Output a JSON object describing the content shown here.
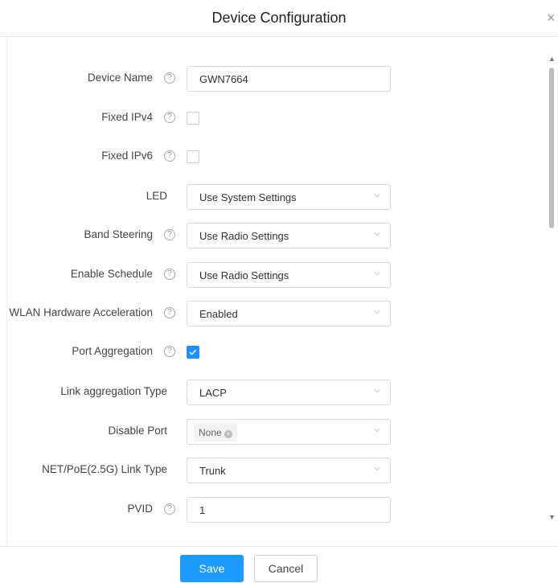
{
  "dialog": {
    "title": "Device Configuration",
    "close_icon": "×"
  },
  "form": {
    "device_name": {
      "label": "Device Name",
      "value": "GWN7664"
    },
    "fixed_ipv4": {
      "label": "Fixed IPv4",
      "checked": false
    },
    "fixed_ipv6": {
      "label": "Fixed IPv6",
      "checked": false
    },
    "led": {
      "label": "LED",
      "value": "Use System Settings"
    },
    "band_steering": {
      "label": "Band Steering",
      "value": "Use Radio Settings"
    },
    "enable_schedule": {
      "label": "Enable Schedule",
      "value": "Use Radio Settings"
    },
    "wlan_hw_accel": {
      "label": "WLAN Hardware Acceleration",
      "value": "Enabled"
    },
    "port_aggregation": {
      "label": "Port Aggregation",
      "checked": true
    },
    "link_aggregation_type": {
      "label": "Link aggregation Type",
      "value": "LACP"
    },
    "disable_port": {
      "label": "Disable Port",
      "tag": "None"
    },
    "net_poe_link_type": {
      "label": "NET/PoE(2.5G) Link Type",
      "value": "Trunk"
    },
    "pvid": {
      "label": "PVID",
      "value": "1"
    }
  },
  "help_icon": "?",
  "footer": {
    "save_label": "Save",
    "cancel_label": "Cancel"
  },
  "colors": {
    "primary": "#1e9bff",
    "checkbox_checked": "#1e90ff"
  }
}
